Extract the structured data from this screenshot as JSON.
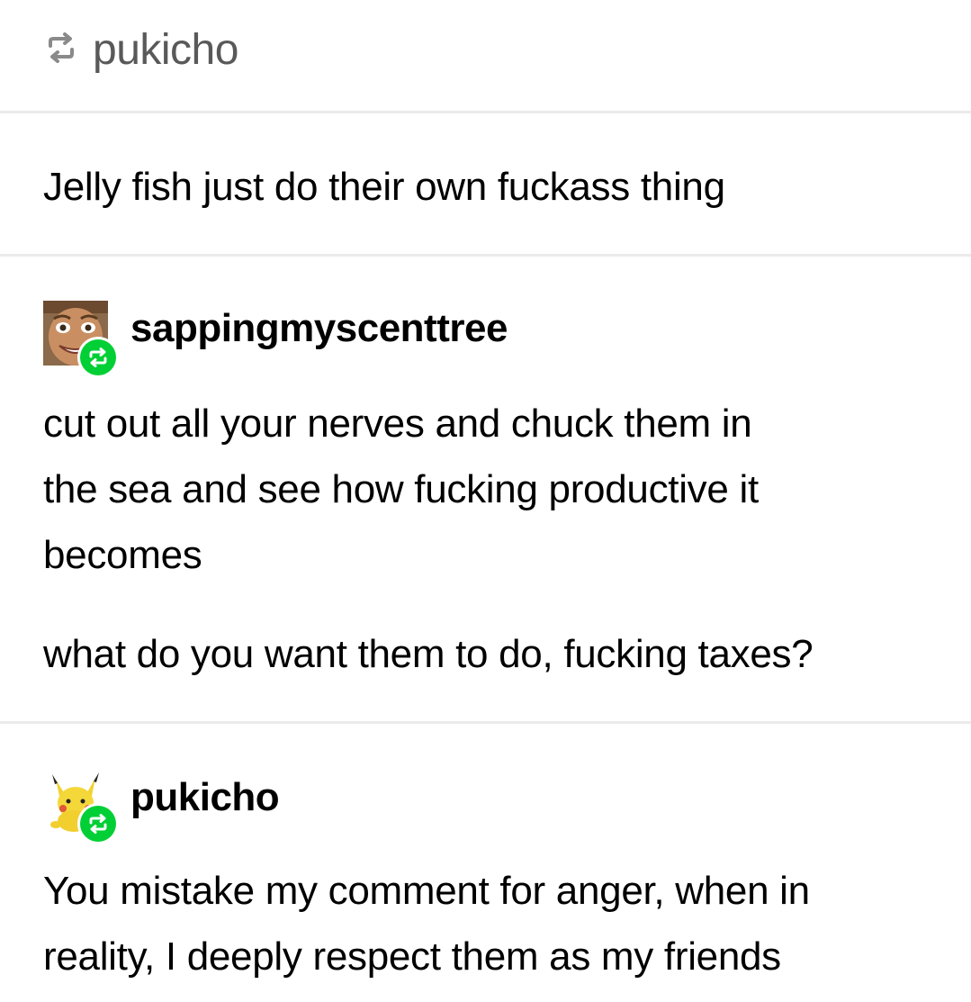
{
  "header": {
    "reblogged_from": "pukicho"
  },
  "original_post": {
    "text": "Jelly fish just do their own fuckass thing"
  },
  "reblog_1": {
    "username": "sappingmyscenttree",
    "paragraphs": [
      "cut out all your nerves and chuck them in",
      "the sea and see how fucking productive it",
      "becomes",
      "what do you want them to do, fucking taxes?"
    ]
  },
  "reblog_2": {
    "username": "pukicho",
    "paragraphs": [
      "You mistake my comment for anger, when in",
      "reality, I deeply respect them as my friends"
    ]
  },
  "colors": {
    "reblog_badge": "#00cf35",
    "header_text": "#595959",
    "divider": "#ebebeb"
  }
}
